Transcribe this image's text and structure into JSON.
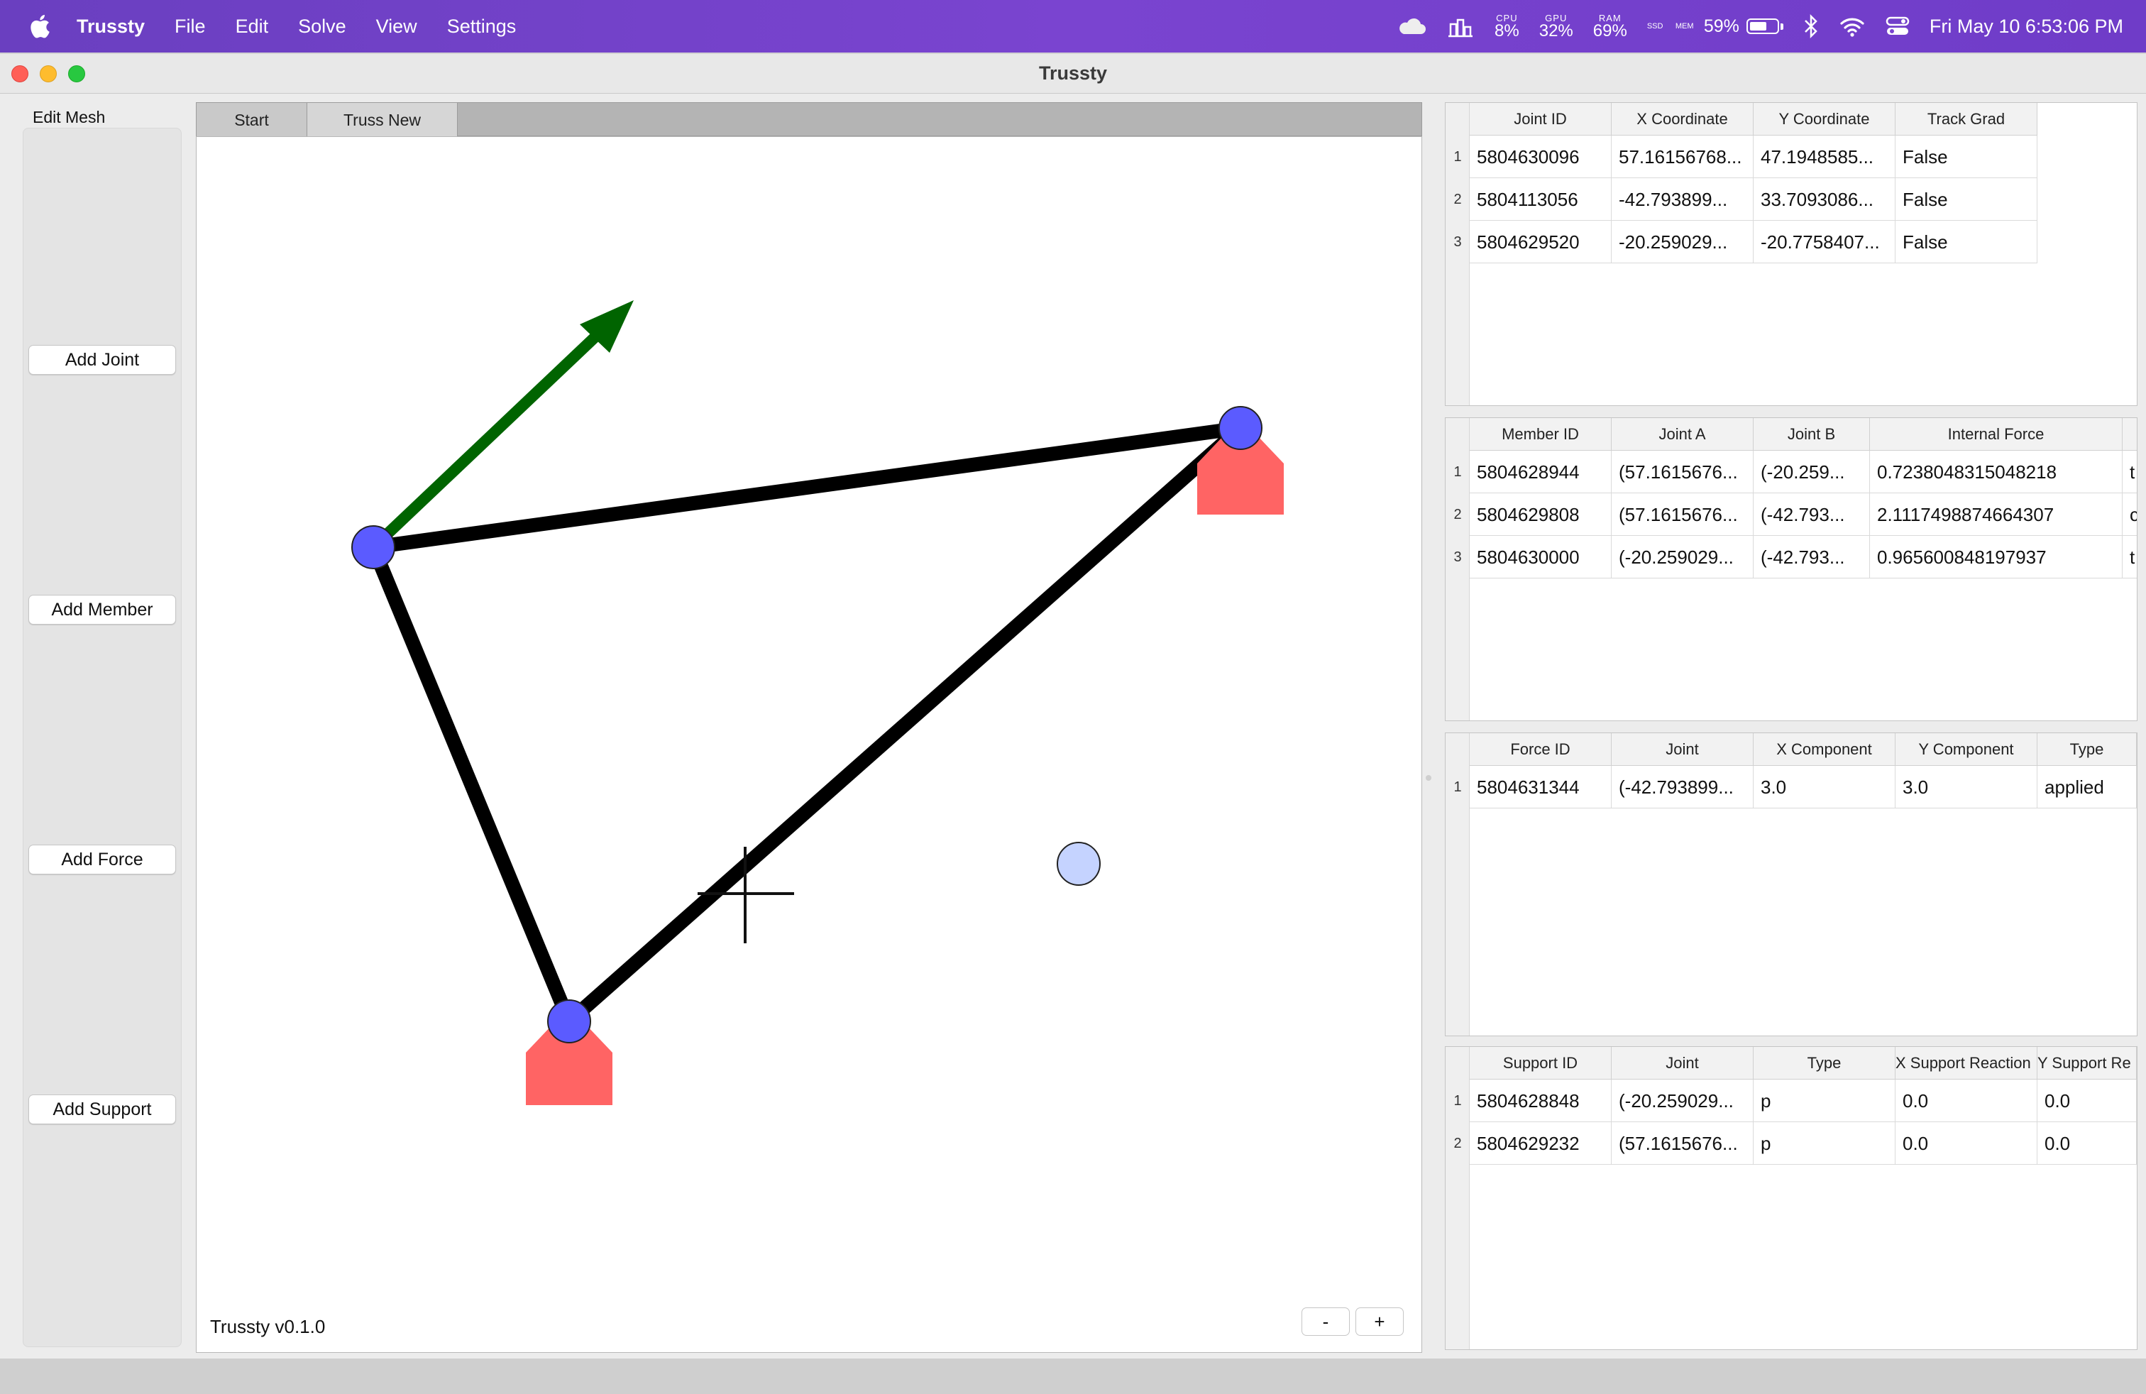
{
  "menubar": {
    "app_name": "Trussty",
    "menus": [
      "File",
      "Edit",
      "Solve",
      "View",
      "Settings"
    ],
    "cpu_label": "CPU",
    "cpu_value": "8%",
    "gpu_label": "GPU",
    "gpu_value": "32%",
    "ram_label": "RAM",
    "ram_value": "69%",
    "ssd_label": "SSD",
    "mem_label": "MEM",
    "battery": "59%",
    "clock": "Fri May 10  6:53:06 PM"
  },
  "window": {
    "title": "Trussty"
  },
  "left_panel": {
    "heading": "Edit Mesh",
    "add_joint": "Add Joint",
    "add_member": "Add Member",
    "add_force": "Add Force",
    "add_support": "Add Support"
  },
  "tabs": [
    "Start",
    "Truss New"
  ],
  "footer": {
    "version": "Trussty v0.1.0",
    "zoom_out": "-",
    "zoom_in": "+"
  },
  "colors": {
    "joint": "#5b5bff",
    "joint_preview": "#c5d3ff",
    "member": "#000000",
    "force_arrow": "#006400",
    "support": "#ff6464"
  },
  "joints_table": {
    "headers": [
      "Joint ID",
      "X Coordinate",
      "Y Coordinate",
      "Track Grad"
    ],
    "rows": [
      [
        "5804630096",
        "57.16156768...",
        "47.1948585...",
        "False"
      ],
      [
        "5804113056",
        "-42.793899...",
        "33.7093086...",
        "False"
      ],
      [
        "5804629520",
        "-20.259029...",
        "-20.7758407...",
        "False"
      ]
    ]
  },
  "members_table": {
    "headers": [
      "Member ID",
      "Joint A",
      "Joint B",
      "Internal Force",
      ""
    ],
    "rows": [
      [
        "5804628944",
        "(57.1615676...",
        "(-20.259...",
        "0.7238048315048218",
        "t"
      ],
      [
        "5804629808",
        "(57.1615676...",
        "(-42.793...",
        "2.1117498874664307",
        "c"
      ],
      [
        "5804630000",
        "(-20.259029...",
        "(-42.793...",
        "0.965600848197937",
        "t"
      ]
    ]
  },
  "forces_table": {
    "headers": [
      "Force ID",
      "Joint",
      "X Component",
      "Y Component",
      "Type"
    ],
    "rows": [
      [
        "5804631344",
        "(-42.793899...",
        "3.0",
        "3.0",
        "applied"
      ]
    ]
  },
  "supports_table": {
    "headers": [
      "Support ID",
      "Joint",
      "Type",
      "X Support Reaction",
      "Y Support Re"
    ],
    "rows": [
      [
        "5804628848",
        "(-20.259029...",
        "p",
        "0.0",
        "0.0"
      ],
      [
        "5804629232",
        "(57.1615676...",
        "p",
        "0.0",
        "0.0"
      ]
    ]
  }
}
